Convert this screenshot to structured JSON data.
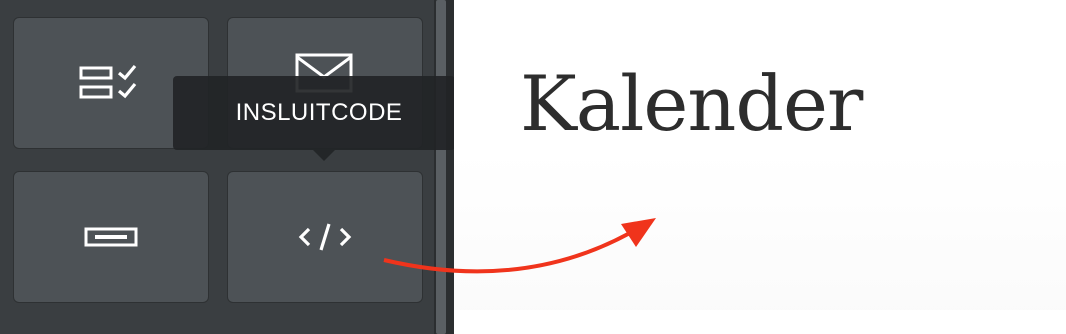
{
  "sidebar": {
    "tiles": [
      {
        "name": "checklist-block",
        "icon": "checklist-icon"
      },
      {
        "name": "contact-form-block",
        "icon": "envelope-icon"
      },
      {
        "name": "button-block",
        "icon": "button-icon"
      },
      {
        "name": "embed-code-block",
        "icon": "code-icon"
      }
    ],
    "tooltip": "INSLUITCODE"
  },
  "canvas": {
    "title": "Kalender"
  },
  "colors": {
    "sidebar_bg": "#3a3e41",
    "tile_bg": "#4d5256",
    "arrow": "#f0341c"
  }
}
